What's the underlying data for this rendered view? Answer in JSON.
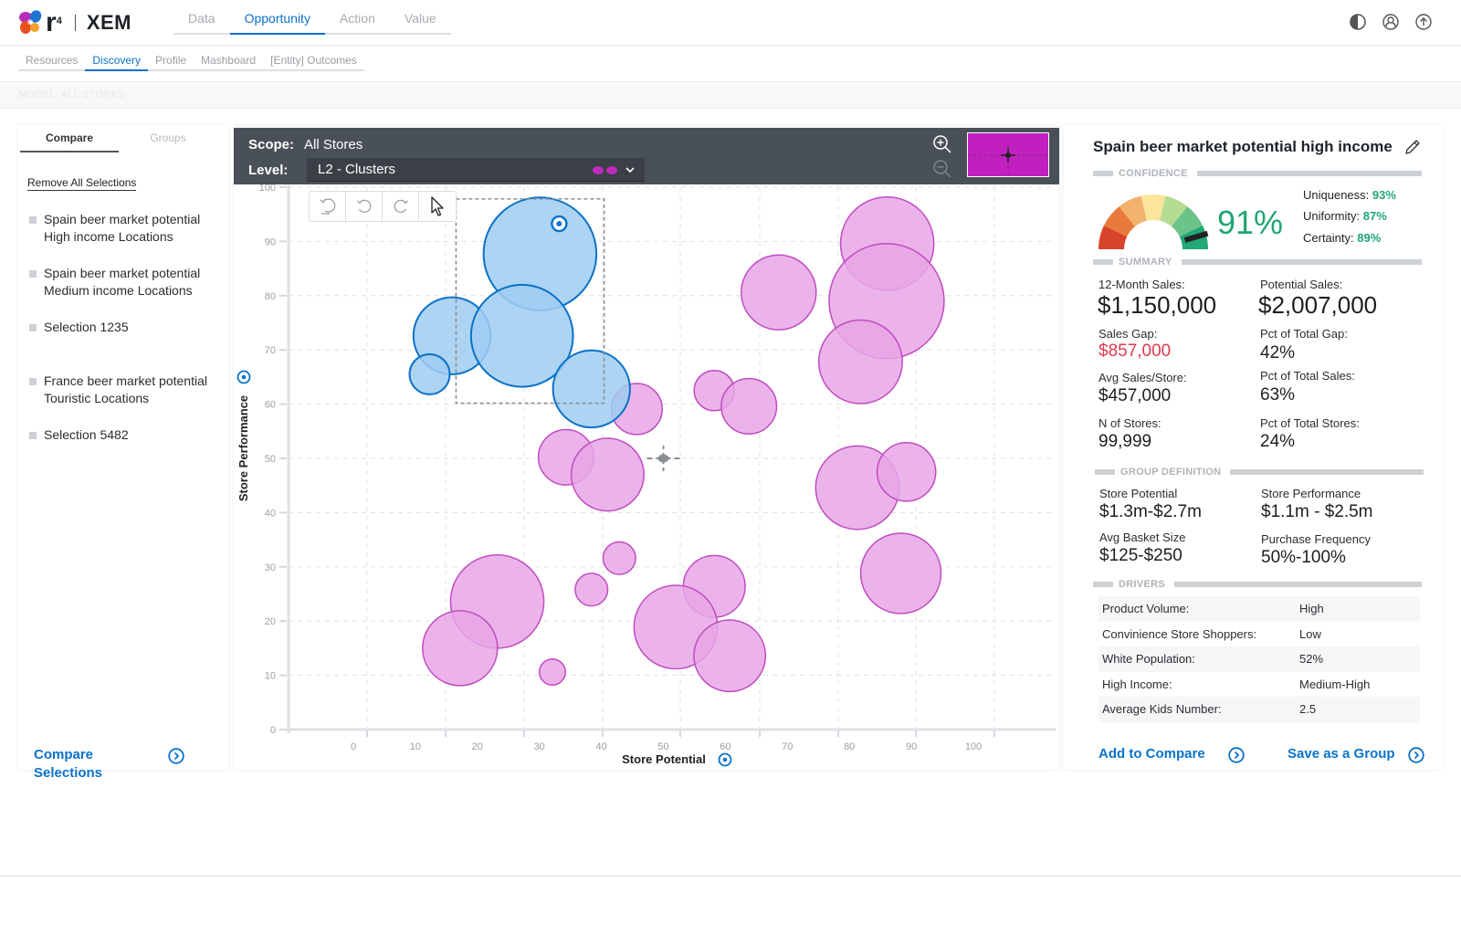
{
  "app": {
    "brand": "r",
    "brand_sup": "4",
    "product": "XEM"
  },
  "main_tabs": [
    {
      "label": "Data",
      "active": false
    },
    {
      "label": "Opportunity",
      "active": true
    },
    {
      "label": "Action",
      "active": false
    },
    {
      "label": "Value",
      "active": false
    }
  ],
  "top_icons": [
    "contrast-icon",
    "user-icon",
    "upload-icon"
  ],
  "sub_tabs": [
    {
      "label": "Resources",
      "active": false
    },
    {
      "label": "Discovery",
      "active": true
    },
    {
      "label": "Profile",
      "active": false
    },
    {
      "label": "Mashboard",
      "active": false
    },
    {
      "label": "[Entity] Outcomes",
      "active": false
    }
  ],
  "model_bar": "MODEL: ALL STORES",
  "left_panel": {
    "tabs": [
      {
        "label": "Compare",
        "active": true
      },
      {
        "label": "Groups",
        "active": false
      }
    ],
    "remove_all": "Remove All Selections",
    "selections": [
      {
        "line1": "Spain beer market potential",
        "line2": "High income Locations"
      },
      {
        "line1": "Spain beer market potential",
        "line2": "Medium income Locations"
      },
      {
        "line1": "Selection 1235",
        "line2": ""
      },
      {
        "line1": "France beer market potential",
        "line2": "Touristic Locations"
      },
      {
        "line1": "Selection 5482",
        "line2": ""
      }
    ],
    "compare_line1": "Compare",
    "compare_line2": "Selections"
  },
  "chart_panel": {
    "scope_label": "Scope:",
    "scope_value": "All Stores",
    "level_label": "Level:",
    "level_value": "L2 - Clusters",
    "accent": "#c020bd"
  },
  "chart_data": {
    "type": "scatter",
    "subtype": "bubble",
    "title": "",
    "xlabel": "Store Potential",
    "ylabel": "Store Performance",
    "xlim": [
      0,
      100
    ],
    "ylim": [
      0,
      100
    ],
    "x_ticks": [
      "0",
      "10",
      "20",
      "30",
      "40",
      "50",
      "60",
      "70",
      "80",
      "90",
      "100"
    ],
    "y_ticks": [
      "0",
      "10",
      "20",
      "30",
      "40",
      "50",
      "60",
      "70",
      "80",
      "90",
      "100"
    ],
    "grid": true,
    "selection_box": {
      "x": [
        17,
        40
      ],
      "y": [
        60,
        98
      ]
    },
    "crosshair": {
      "x": 50,
      "y": 50
    },
    "series": [
      {
        "name": "Selected",
        "fill": "#9fcdf1",
        "stroke": "#0a72c9",
        "points": [
          {
            "x": 30.1,
            "y": 87.7,
            "size": 10.4,
            "focused": true
          },
          {
            "x": 15.9,
            "y": 72.6,
            "size": 7.1
          },
          {
            "x": 27.2,
            "y": 72.6,
            "size": 9.4
          },
          {
            "x": 12.3,
            "y": 65.5,
            "size": 3.7
          },
          {
            "x": 38.4,
            "y": 62.8,
            "size": 7.1
          }
        ]
      },
      {
        "name": "Clusters",
        "fill": "#e8a6e6",
        "stroke": "#c04cc0",
        "points": [
          {
            "x": 86.1,
            "y": 89.6,
            "size": 8.6
          },
          {
            "x": 86.0,
            "y": 79.0,
            "size": 10.6
          },
          {
            "x": 68.6,
            "y": 80.6,
            "size": 6.9
          },
          {
            "x": 81.8,
            "y": 67.8,
            "size": 7.7
          },
          {
            "x": 58.2,
            "y": 62.5,
            "size": 3.7
          },
          {
            "x": 63.8,
            "y": 59.6,
            "size": 5.1
          },
          {
            "x": 45.7,
            "y": 59.1,
            "size": 4.7
          },
          {
            "x": 34.3,
            "y": 50.2,
            "size": 5.1
          },
          {
            "x": 41.0,
            "y": 47.0,
            "size": 6.7
          },
          {
            "x": 81.3,
            "y": 44.6,
            "size": 7.7
          },
          {
            "x": 89.2,
            "y": 47.5,
            "size": 5.4
          },
          {
            "x": 42.9,
            "y": 31.6,
            "size": 3.0
          },
          {
            "x": 38.4,
            "y": 25.8,
            "size": 3.0
          },
          {
            "x": 23.2,
            "y": 23.6,
            "size": 8.6
          },
          {
            "x": 17.2,
            "y": 15.0,
            "size": 6.9
          },
          {
            "x": 32.1,
            "y": 10.6,
            "size": 2.4
          },
          {
            "x": 58.2,
            "y": 26.4,
            "size": 5.7
          },
          {
            "x": 52.0,
            "y": 18.9,
            "size": 7.7
          },
          {
            "x": 60.7,
            "y": 13.6,
            "size": 6.6
          },
          {
            "x": 88.3,
            "y": 28.8,
            "size": 7.4
          }
        ]
      }
    ]
  },
  "right_panel": {
    "title": "Spain beer market potential high income",
    "confidence": {
      "heading": "CONFIDENCE",
      "value": 91,
      "value_label": "91%",
      "metrics": [
        {
          "label": "Uniqueness:",
          "value": "93%"
        },
        {
          "label": "Uniformity:",
          "value": "87%"
        },
        {
          "label": "Certainty:",
          "value": "89%"
        }
      ],
      "gauge_colors": [
        "#d8432b",
        "#e97a3d",
        "#f1b26b",
        "#fbe59b",
        "#b5dc93",
        "#6cc38a",
        "#21a874"
      ]
    },
    "summary": {
      "heading": "SUMMARY",
      "month_sales_label": "12-Month Sales:",
      "month_sales_value": "$1,150,000",
      "potential_sales_label": "Potential Sales:",
      "potential_sales_value": "$2,007,000",
      "sales_gap_label": "Sales Gap:",
      "sales_gap_value": "$857,000",
      "pct_gap_label": "Pct of Total Gap:",
      "pct_gap_value": "42%",
      "avg_sales_label": "Avg Sales/Store:",
      "avg_sales_value": "$457,000",
      "pct_sales_label": "Pct of Total Sales:",
      "pct_sales_value": "63%",
      "n_stores_label": "N of Stores:",
      "n_stores_value": "99,999",
      "pct_stores_label": "Pct of Total Stores:",
      "pct_stores_value": "24%"
    },
    "group_definition": {
      "heading": "GROUP DEFINITION",
      "items": [
        {
          "label": "Store Potential",
          "value": "$1.3m-$2.7m"
        },
        {
          "label": "Store Performance",
          "value": "$1.1m - $2.5m"
        },
        {
          "label": "Avg Basket Size",
          "value": "$125-$250"
        },
        {
          "label": "Purchase Frequency",
          "value": "50%-100%"
        }
      ]
    },
    "drivers": {
      "heading": "DRIVERS",
      "rows": [
        {
          "label": "Product Volume:",
          "value": "High"
        },
        {
          "label": "Convinience Store Shoppers:",
          "value": "Low"
        },
        {
          "label": "White Population:",
          "value": "52%"
        },
        {
          "label": "High Income:",
          "value": "Medium-High"
        },
        {
          "label": "Average Kids Number:",
          "value": "2.5"
        }
      ]
    },
    "add_to_compare": "Add to Compare",
    "save_as_group": "Save as a Group"
  }
}
